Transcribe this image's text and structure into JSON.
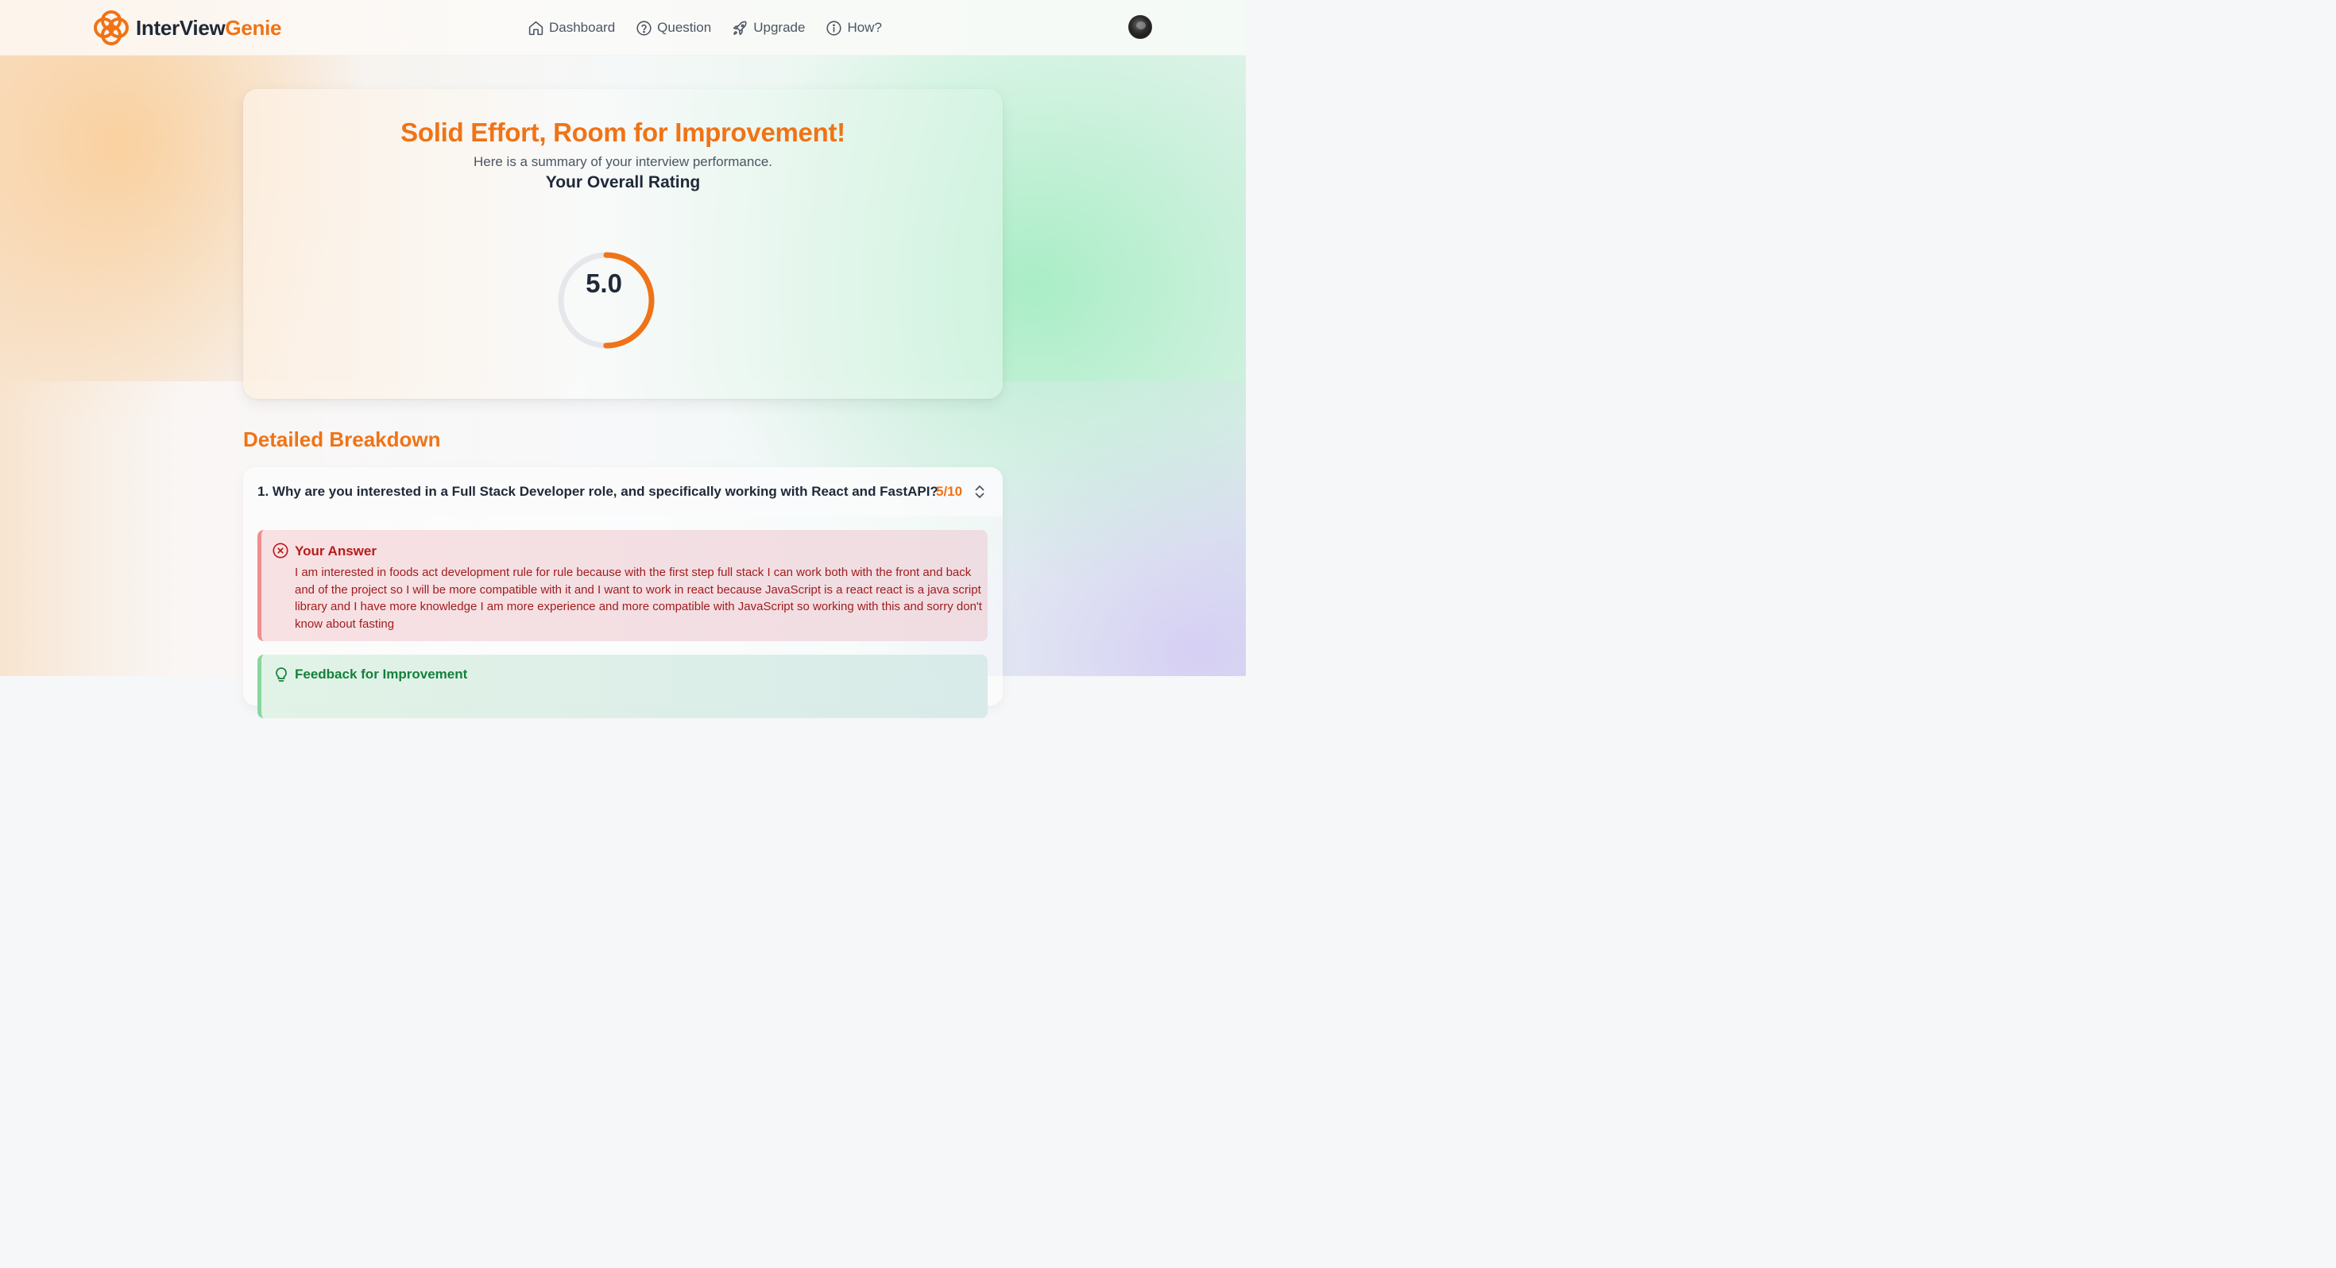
{
  "colors": {
    "brand_orange": "#f07316",
    "text_dark": "#1f2937",
    "answer_red": "#b91c1c",
    "feedback_green": "#15803d",
    "gauge_track": "#e5e7eb"
  },
  "header": {
    "brand_part1": "InterView",
    "brand_part2": "Genie",
    "logo_icon": "interlocking-rings-logo",
    "nav": [
      {
        "label": "Dashboard",
        "icon": "home-icon"
      },
      {
        "label": "Question",
        "icon": "question-circle-icon"
      },
      {
        "label": "Upgrade",
        "icon": "rocket-icon"
      },
      {
        "label": "How?",
        "icon": "info-circle-icon"
      }
    ],
    "avatar_icon": "user-avatar"
  },
  "summary": {
    "title": "Solid Effort, Room for Improvement!",
    "subtitle": "Here is a summary of your interview performance.",
    "rating_label": "Your Overall Rating",
    "rating_value": "5.0",
    "rating_fraction": 0.5
  },
  "breakdown": {
    "section_title": "Detailed Breakdown",
    "questions": [
      {
        "question": "1. Why are you interested in a Full Stack Developer role, and specifically working with React and FastAPI?",
        "score": "5/10",
        "answer_title": "Your Answer",
        "answer_text": "I am interested in foods act development rule for rule because with the first step full stack I can work both with the front and back and of the project so I will be more compatible with it and I want to work in react because JavaScript is a react react is a java script library and I have more knowledge I am more experience and more compatible with JavaScript so working with this and sorry don't know about fasting",
        "feedback_title": "Feedback for Improvement"
      }
    ]
  }
}
